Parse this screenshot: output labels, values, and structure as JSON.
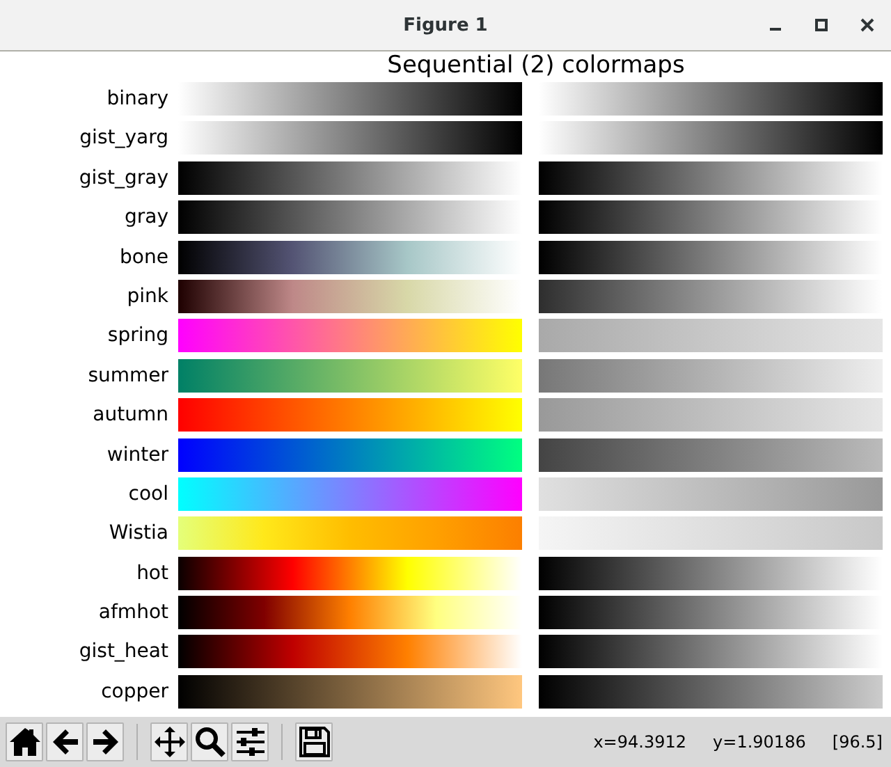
{
  "window": {
    "title": "Figure 1"
  },
  "figure": {
    "title": "Sequential (2) colormaps",
    "colormaps": [
      {
        "name": "binary"
      },
      {
        "name": "gist_yarg"
      },
      {
        "name": "gist_gray"
      },
      {
        "name": "gray"
      },
      {
        "name": "bone"
      },
      {
        "name": "pink"
      },
      {
        "name": "spring"
      },
      {
        "name": "summer"
      },
      {
        "name": "autumn"
      },
      {
        "name": "winter"
      },
      {
        "name": "cool"
      },
      {
        "name": "Wistia"
      },
      {
        "name": "hot"
      },
      {
        "name": "afmhot"
      },
      {
        "name": "gist_heat"
      },
      {
        "name": "copper"
      }
    ]
  },
  "toolbar": {
    "buttons": [
      {
        "kind": "home"
      },
      {
        "kind": "back"
      },
      {
        "kind": "forward"
      },
      {
        "kind": "separator"
      },
      {
        "kind": "pan"
      },
      {
        "kind": "zoom"
      },
      {
        "kind": "configure"
      },
      {
        "kind": "separator"
      },
      {
        "kind": "save"
      }
    ],
    "coordinates": "x=94.3912     y=1.90186     [96.5]"
  }
}
